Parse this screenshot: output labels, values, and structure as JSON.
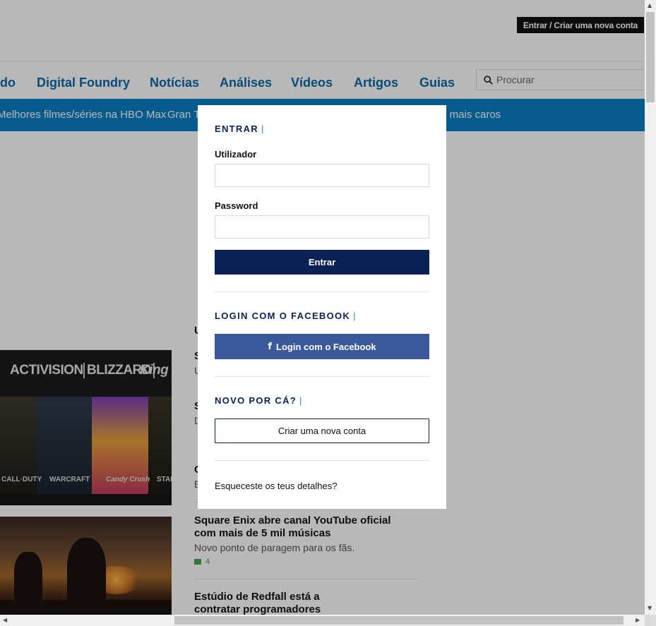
{
  "header": {
    "account_button": "Entrar / Criar uma nova conta"
  },
  "nav": {
    "items": [
      "do",
      "Digital Foundry",
      "Notícias",
      "Análises",
      "Vídeos",
      "Artigos",
      "Guias"
    ],
    "search_placeholder": "Procurar"
  },
  "subnav": {
    "items": [
      "Melhores filmes/séries na HBO Max",
      "Gran T",
      "s mais caros"
    ]
  },
  "articles": {
    "section_fragment": "U",
    "frag1": "S",
    "frag1_desc": "U",
    "frag2": "S",
    "frag2_desc": "D",
    "frag3": "C",
    "frag3_desc": "E",
    "image1_logos": [
      "ACTIVISION",
      "BLIZZARD",
      "King"
    ],
    "image1_labels": [
      "CALL·DUTY",
      "WARCRAFT",
      "Candy Crush",
      "STAR"
    ],
    "article1": {
      "title": "Square Enix abre canal YouTube oficial com mais de 5 mil músicas",
      "desc": "Novo ponto de paragem para os fãs.",
      "comments": "4"
    },
    "article2": {
      "title": "Estúdio de Redfall está a contratar programadores"
    }
  },
  "modal": {
    "login_heading": "ENTRAR",
    "heading_separator": "|",
    "username_label": "Utilizador",
    "username_value": "",
    "password_label": "Password",
    "password_value": "",
    "submit_label": "Entrar",
    "facebook_heading": "LOGIN COM O FACEBOOK",
    "facebook_icon_glyph": "f",
    "facebook_button": "Login com o Facebook",
    "new_heading": "NOVO POR CÁ?",
    "create_button": "Criar uma nova conta",
    "forgot_link": "Esqueceste os teus detalhes?"
  },
  "colors": {
    "brand_blue": "#0a7fc2",
    "nav_text": "#0a6aa8",
    "modal_navy": "#0b2154",
    "facebook_blue": "#3b5998",
    "comment_green": "#48a14d"
  },
  "scrollbars": {
    "up_arrow": "▲",
    "down_arrow": "▼",
    "left_arrow": "◀",
    "right_arrow": "▶"
  }
}
